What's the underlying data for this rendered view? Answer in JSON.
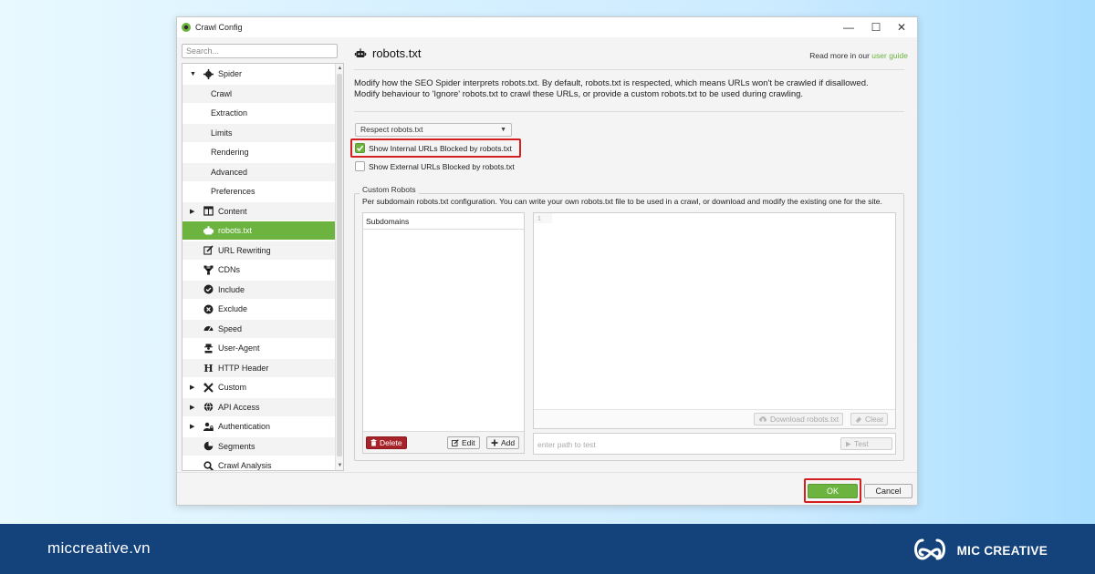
{
  "window": {
    "title": "Crawl Config",
    "minimize": "—",
    "maximize": "☐",
    "close": "✕"
  },
  "sidebar": {
    "search_placeholder": "Search...",
    "items": [
      {
        "label": "Spider",
        "type": "parent",
        "expanded": true,
        "icon": "gear-icon"
      },
      {
        "label": "Crawl",
        "type": "child"
      },
      {
        "label": "Extraction",
        "type": "child"
      },
      {
        "label": "Limits",
        "type": "child"
      },
      {
        "label": "Rendering",
        "type": "child"
      },
      {
        "label": "Advanced",
        "type": "child"
      },
      {
        "label": "Preferences",
        "type": "child"
      },
      {
        "label": "Content",
        "type": "parent",
        "expanded": false,
        "icon": "table-icon"
      },
      {
        "label": "robots.txt",
        "type": "item",
        "selected": true,
        "icon": "robot-icon"
      },
      {
        "label": "URL Rewriting",
        "type": "item",
        "icon": "edit-icon"
      },
      {
        "label": "CDNs",
        "type": "item",
        "icon": "network-icon"
      },
      {
        "label": "Include",
        "type": "item",
        "icon": "check-circle-icon"
      },
      {
        "label": "Exclude",
        "type": "item",
        "icon": "x-circle-icon"
      },
      {
        "label": "Speed",
        "type": "item",
        "icon": "gauge-icon"
      },
      {
        "label": "User-Agent",
        "type": "item",
        "icon": "agent-icon"
      },
      {
        "label": "HTTP Header",
        "type": "item",
        "icon": "h-icon"
      },
      {
        "label": "Custom",
        "type": "parent",
        "expanded": false,
        "icon": "tools-icon"
      },
      {
        "label": "API Access",
        "type": "parent",
        "expanded": false,
        "icon": "globe-icon"
      },
      {
        "label": "Authentication",
        "type": "parent",
        "expanded": false,
        "icon": "user-lock-icon"
      },
      {
        "label": "Segments",
        "type": "item",
        "icon": "pie-icon"
      },
      {
        "label": "Crawl Analysis",
        "type": "item",
        "icon": "search-icon"
      }
    ]
  },
  "main": {
    "title": "robots.txt",
    "read_more_prefix": "Read more in our ",
    "read_more_link": "user guide",
    "description_line1": "Modify how the SEO Spider interprets robots.txt. By default, robots.txt is respected, which means URLs won't be crawled if disallowed.",
    "description_line2": "Modify behaviour to 'Ignore' robots.txt to crawl these URLs, or provide a custom robots.txt to be used during crawling.",
    "mode_select": "Respect robots.txt",
    "show_internal_label": "Show Internal URLs Blocked by robots.txt",
    "show_internal_checked": true,
    "show_external_label": "Show External URLs Blocked by robots.txt",
    "show_external_checked": false,
    "custom_robots": {
      "title": "Custom Robots",
      "description": "Per subdomain robots.txt configuration. You can write your own robots.txt file to be used in a crawl, or download and modify the existing one for the site.",
      "subdomains_header": "Subdomains",
      "delete_label": "Delete",
      "edit_label": "Edit",
      "add_label": "Add",
      "line_number": "1",
      "download_label": "Download robots.txt",
      "clear_label": "Clear",
      "test_placeholder": "enter path to test",
      "test_label": "Test"
    },
    "ok_label": "OK",
    "cancel_label": "Cancel"
  },
  "footer": {
    "site": "miccreative.vn",
    "brand": "MIC CREATIVE"
  },
  "colors": {
    "accent": "#6cb33f",
    "highlight": "#d31f1f",
    "delete": "#a6232a",
    "footer": "#14427a"
  }
}
